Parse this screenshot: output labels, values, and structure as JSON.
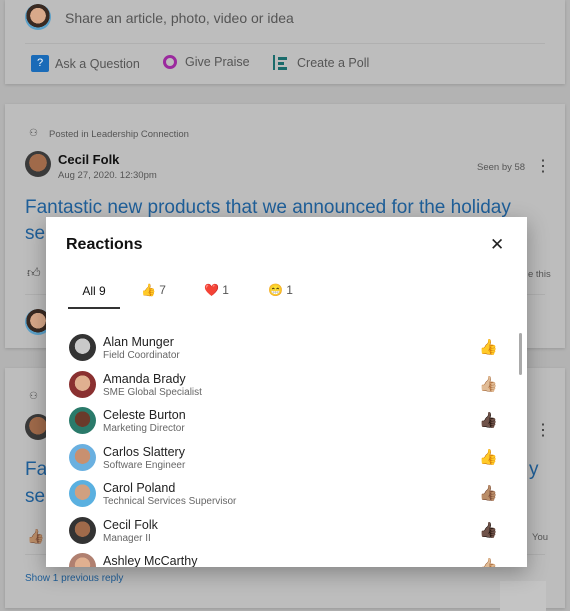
{
  "composer": {
    "placeholder": "Share an article, photo, video or idea",
    "actions": [
      {
        "label": "Ask a Question",
        "icon": "question-icon"
      },
      {
        "label": "Give Praise",
        "icon": "praise-badge-icon"
      },
      {
        "label": "Create a Poll",
        "icon": "poll-icon"
      }
    ]
  },
  "post": {
    "posted_in": "Posted in Leadership Connection",
    "author": "Cecil Folk",
    "date": "Aug 27, 2020. 12:30pm",
    "seen_by": "Seen by 58",
    "text_line1": "Fantastic new products that we announced for the holiday",
    "text_line2": "se",
    "like_partial": "e this"
  },
  "post2": {
    "text_line1": "Fa",
    "text_line2": "se",
    "partial_right": "y",
    "you": "You",
    "show_replies": "Show 1 previous reply"
  },
  "modal": {
    "title": "Reactions",
    "tabs": [
      {
        "label": "All 9",
        "count": ""
      },
      {
        "emoji": "👍",
        "count": "7"
      },
      {
        "emoji": "❤️",
        "count": "1"
      },
      {
        "emoji": "😁",
        "count": "1"
      }
    ],
    "people": [
      {
        "name": "Alan Munger",
        "title": "Field Coordinator",
        "reaction": "👍",
        "color": "#e8b93a"
      },
      {
        "name": "Amanda Brady",
        "title": "SME Global Specialist",
        "reaction": "👍🏼",
        "color": "#e0c3a3"
      },
      {
        "name": "Celeste Burton",
        "title": "Marketing Director",
        "reaction": "👍🏿",
        "color": "#5a3a2a"
      },
      {
        "name": "Carlos Slattery",
        "title": "Software Engineer",
        "reaction": "👍",
        "color": "#e8b93a"
      },
      {
        "name": "Carol Poland",
        "title": "Technical Services Supervisor",
        "reaction": "👍🏽",
        "color": "#9a6a44"
      },
      {
        "name": "Cecil Folk",
        "title": "Manager II",
        "reaction": "👍🏿",
        "color": "#5a3a2a"
      },
      {
        "name": "Ashley McCarthy",
        "title": "",
        "reaction": "👍🏼",
        "color": "#e0c3a3"
      }
    ]
  },
  "colors": {
    "accent": "#1f5f99",
    "tab_underline": "#333333",
    "overlay": "#b3b3b3"
  }
}
